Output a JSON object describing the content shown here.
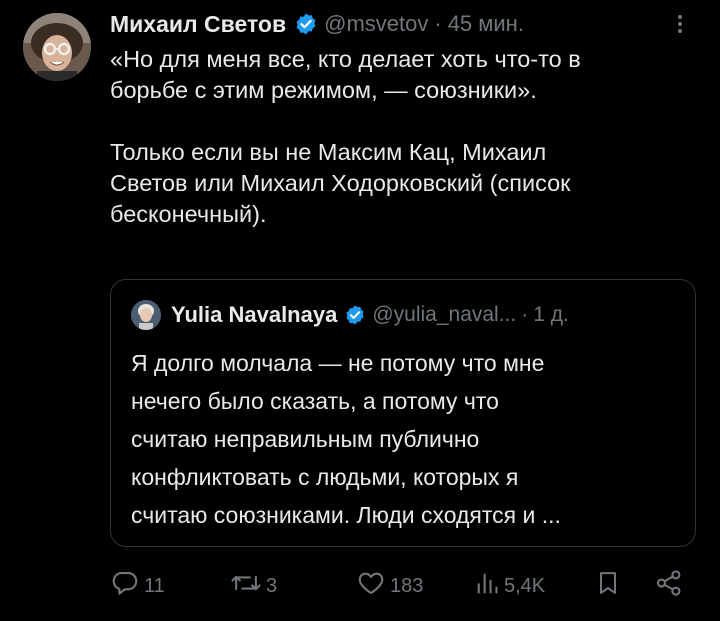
{
  "tweet": {
    "author_name": "Михаил Светов",
    "handle": "@msvetov",
    "separator": "·",
    "time": "45 мин.",
    "text": "«Но для меня все, кто делает хоть что-то в\nборьбе с этим режимом, — союзники».\n\nТолько если вы не Максим Кац, Михаил\nСветов или Михаил Ходорковский (список\nбесконечный)."
  },
  "quote": {
    "author_name": "Yulia Navalnaya",
    "handle": "@yulia_naval...",
    "separator": "·",
    "time": "1 д.",
    "text": "Я долго молчала — не потому что мне\nнечего было сказать, а потому что\nсчитаю неправильным публично\nконфликтовать с людьми, которых я\nсчитаю союзниками. Люди сходятся и ..."
  },
  "actions": {
    "replies": "11",
    "reposts": "3",
    "likes": "183",
    "views": "5,4K"
  },
  "icons": {
    "verified": "verified-badge-icon",
    "more": "more-icon",
    "reply": "reply-icon",
    "repost": "repost-icon",
    "like": "heart-icon",
    "views": "views-icon",
    "bookmark": "bookmark-icon",
    "share": "share-icon"
  },
  "colors": {
    "background": "#000000",
    "text": "#e7e9ea",
    "muted": "#71767b",
    "verified": "#1d9bf0",
    "border": "#2f3336"
  }
}
